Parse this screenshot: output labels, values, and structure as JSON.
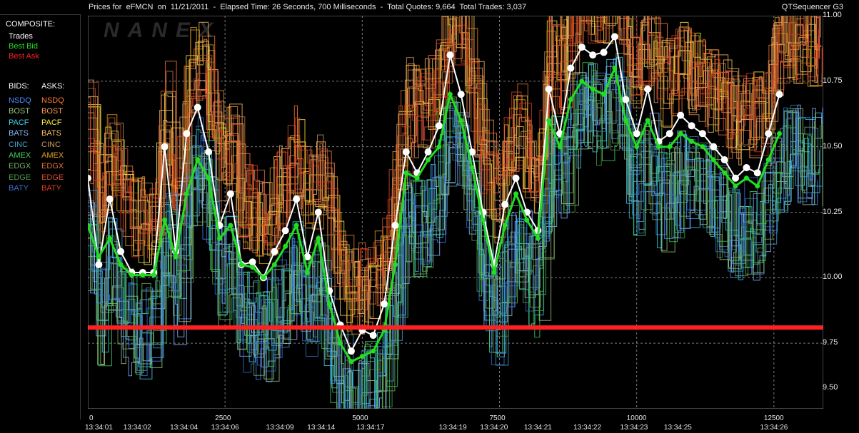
{
  "header": {
    "title": "Prices for  eFMCN  on  11/21/2011  -  Elapsed Time: 26 Seconds, 700 Milliseconds  -  Total Quotes: 9,664  Total Trades: 3,037",
    "app_name": "QTSequencer G3",
    "watermark": "NANEX"
  },
  "legend": {
    "composite_title": "COMPOSITE:",
    "composite_items": [
      {
        "label": "Trades",
        "color": "#ffffff"
      },
      {
        "label": "Best Bid",
        "color": "#22dd22"
      },
      {
        "label": "Best Ask",
        "color": "#ff2020"
      }
    ],
    "bids_title": "BIDS:",
    "asks_title": "ASKS:",
    "exchanges": [
      {
        "bid": "NSDQ",
        "ask": "NSDQ",
        "bid_color": "#4a8cff",
        "ask_color": "#ff7a30"
      },
      {
        "bid": "BOST",
        "ask": "BOST",
        "bid_color": "#9ec97a",
        "ask_color": "#ff9a55"
      },
      {
        "bid": "PACF",
        "ask": "PACF",
        "bid_color": "#38d8f0",
        "ask_color": "#ffee40"
      },
      {
        "bid": "BATS",
        "ask": "BATS",
        "bid_color": "#8ab8ff",
        "ask_color": "#ffc060"
      },
      {
        "bid": "CINC",
        "ask": "CINC",
        "bid_color": "#4aa0c8",
        "ask_color": "#d09a60"
      },
      {
        "bid": "AMEX",
        "ask": "AMEX",
        "bid_color": "#40d060",
        "ask_color": "#e0a020"
      },
      {
        "bid": "EDGX",
        "ask": "EDGX",
        "bid_color": "#70b060",
        "ask_color": "#e07040"
      },
      {
        "bid": "EDGE",
        "ask": "EDGE",
        "bid_color": "#509850",
        "ask_color": "#d05030"
      },
      {
        "bid": "BATY",
        "ask": "BATY",
        "bid_color": "#3a70d0",
        "ask_color": "#e03a20"
      }
    ]
  },
  "chart_data": {
    "type": "line",
    "ylim": [
      9.5,
      11.0
    ],
    "y_ticks": [
      "11.00",
      "10.75",
      "10.50",
      "10.25",
      "10.00",
      "9.75",
      "9.50"
    ],
    "xlim": [
      0,
      13400
    ],
    "x_ticks_seq": [
      "0",
      "2500",
      "5000",
      "7500",
      "10000",
      "12500"
    ],
    "x_ticks_time": [
      {
        "x": 0,
        "label": "13:34:01"
      },
      {
        "x": 700,
        "label": "13:34:02"
      },
      {
        "x": 1550,
        "label": "13:34:04"
      },
      {
        "x": 2300,
        "label": "13:34:06"
      },
      {
        "x": 3300,
        "label": "13:34:09"
      },
      {
        "x": 4050,
        "label": "13:34:14"
      },
      {
        "x": 4950,
        "label": "13:34:17"
      },
      {
        "x": 6450,
        "label": "13:34:19"
      },
      {
        "x": 7200,
        "label": "13:34:20"
      },
      {
        "x": 8000,
        "label": "13:34:21"
      },
      {
        "x": 8900,
        "label": "13:34:22"
      },
      {
        "x": 9750,
        "label": "13:34:23"
      },
      {
        "x": 10550,
        "label": "13:34:25"
      },
      {
        "x": 12300,
        "label": "13:34:26"
      }
    ],
    "grid": true,
    "series": [
      {
        "name": "Trades",
        "color": "#ffffff",
        "x": [
          0,
          200,
          400,
          600,
          800,
          1000,
          1200,
          1400,
          1600,
          1800,
          2000,
          2200,
          2400,
          2600,
          2800,
          3000,
          3200,
          3400,
          3600,
          3800,
          4000,
          4200,
          4400,
          4600,
          4800,
          5000,
          5200,
          5400,
          5600,
          5800,
          6000,
          6200,
          6400,
          6600,
          6800,
          7000,
          7200,
          7400,
          7600,
          7800,
          8000,
          8200,
          8400,
          8600,
          8800,
          9000,
          9200,
          9400,
          9600,
          9800,
          10000,
          10200,
          10400,
          10600,
          10800,
          11000,
          11200,
          11400,
          11600,
          11800,
          12000,
          12200,
          12400,
          12600
        ],
        "values": [
          10.38,
          10.05,
          10.3,
          10.1,
          10.02,
          10.02,
          10.02,
          10.5,
          10.1,
          10.55,
          10.65,
          10.48,
          10.2,
          10.32,
          10.05,
          10.06,
          10.0,
          10.1,
          10.18,
          10.3,
          10.08,
          10.25,
          9.95,
          9.82,
          9.72,
          9.8,
          9.78,
          9.9,
          10.2,
          10.48,
          10.4,
          10.48,
          10.58,
          10.85,
          10.7,
          10.48,
          10.25,
          10.05,
          10.28,
          10.38,
          10.25,
          10.18,
          10.72,
          10.55,
          10.8,
          10.88,
          10.85,
          10.86,
          10.92,
          10.68,
          10.55,
          10.72,
          10.52,
          10.55,
          10.62,
          10.58,
          10.55,
          10.5,
          10.45,
          10.38,
          10.42,
          10.4,
          10.55,
          10.7
        ]
      },
      {
        "name": "Best Bid",
        "color": "#22dd22",
        "x": [
          0,
          200,
          400,
          600,
          800,
          1000,
          1200,
          1400,
          1600,
          1800,
          2000,
          2200,
          2400,
          2600,
          2800,
          3000,
          3200,
          3400,
          3600,
          3800,
          4000,
          4200,
          4400,
          4600,
          4800,
          5000,
          5200,
          5400,
          5600,
          5800,
          6000,
          6200,
          6400,
          6600,
          6800,
          7000,
          7200,
          7400,
          7600,
          7800,
          8000,
          8200,
          8400,
          8600,
          8800,
          9000,
          9200,
          9400,
          9600,
          9800,
          10000,
          10200,
          10400,
          10600,
          10800,
          11000,
          11200,
          11400,
          11600,
          11800,
          12000,
          12200,
          12400,
          12600
        ],
        "values": [
          10.2,
          10.08,
          10.15,
          10.05,
          10.01,
          10.01,
          10.01,
          10.22,
          10.08,
          10.32,
          10.45,
          10.38,
          10.15,
          10.2,
          10.05,
          10.04,
          10.0,
          10.05,
          10.12,
          10.2,
          10.02,
          10.15,
          9.9,
          9.75,
          9.68,
          9.7,
          9.72,
          9.8,
          10.05,
          10.4,
          10.38,
          10.45,
          10.5,
          10.7,
          10.6,
          10.42,
          10.22,
          10.02,
          10.2,
          10.32,
          10.22,
          10.15,
          10.6,
          10.5,
          10.68,
          10.75,
          10.72,
          10.7,
          10.8,
          10.6,
          10.5,
          10.6,
          10.5,
          10.5,
          10.55,
          10.52,
          10.5,
          10.45,
          10.4,
          10.35,
          10.38,
          10.35,
          10.45,
          10.55
        ]
      },
      {
        "name": "Best Ask",
        "color": "#ff2020",
        "x": [
          0,
          13400
        ],
        "values": [
          9.81,
          9.81
        ]
      }
    ]
  }
}
